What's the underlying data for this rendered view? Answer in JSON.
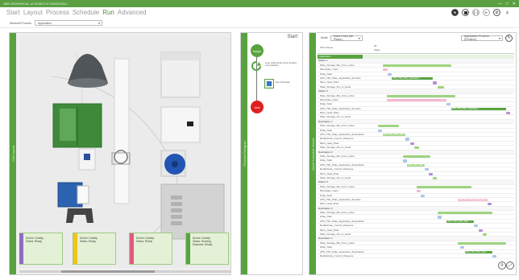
{
  "window": {
    "title": "ABB   GRAPHICAL-UI   ROBOTIC WORKCELL",
    "controls": [
      "—",
      "□",
      "✕"
    ]
  },
  "menu": {
    "items": [
      {
        "label": "Start",
        "active": false
      },
      {
        "label": "Layout",
        "active": false
      },
      {
        "label": "Process",
        "active": false
      },
      {
        "label": "Schedule",
        "active": false
      },
      {
        "label": "Run",
        "active": true
      },
      {
        "label": "Advanced",
        "active": false
      }
    ]
  },
  "toolbar": {
    "icons": [
      "record-icon",
      "stop-icon",
      "pause-icon",
      "play-icon",
      "settings-icon",
      "user-icon"
    ]
  },
  "workspace": {
    "label": "Workcell Process",
    "selected": "Application"
  },
  "layout_panel": {
    "strip_label": "Cell Layout",
    "devices": [
      {
        "name": "Device: Dosibly",
        "status": "Status: Ready",
        "stripe": "#8e6cc2"
      },
      {
        "name": "Device: Dosibly",
        "status": "Status: Ready",
        "stripe": "#f0c419"
      },
      {
        "name": "Device: Dosibly",
        "status": "Status: Ready",
        "stripe": "#e05a7c"
      },
      {
        "name": "Device: Dosibly",
        "status": "Status: Running",
        "extra": "Dispense: Ready",
        "stripe": "#58a33f"
      }
    ]
  },
  "flow_panel": {
    "strip_label": "Process Designer",
    "title": "Start",
    "begin": "begin",
    "end": "end",
    "loop_note": "Loop while all the work remains uncompleted",
    "task_note": "Run Schedule",
    "colors": {
      "begin": "#58a33f",
      "end": "#e02020"
    }
  },
  "gantt_panel": {
    "strip_label": "Gantt Schedule Viewer",
    "mode_label": "Mode",
    "mode_value": "Gantt Chart (All Plates)",
    "filter_value": "Application Process (Runtime)",
    "header_left": "Show Steps",
    "header_mid": "00",
    "header_sub": "Steps",
    "highlight_label": "Application",
    "rows": [
      {
        "label": "Station 1",
        "group": true
      },
      {
        "label": "Plate_Storage_Bot_From_Hotel",
        "bars": [
          [
            0.05,
            0.55,
            "#9ed480"
          ]
        ]
      },
      {
        "label": "Microplate_Open",
        "bars": [
          [
            0.05,
            0.09,
            "#f5b8cf"
          ]
        ]
      },
      {
        "label": "Wrap_Start",
        "bars": [
          [
            0.09,
            0.12,
            "#a6c7e8"
          ]
        ]
      },
      {
        "label": "APS_TSK_Plate_Application_Domain",
        "bars": [
          [
            0.12,
            0.42,
            "#58a33f"
          ]
        ],
        "inline": "APS_TSK_Plate_Application"
      },
      {
        "label": "Micro_Seal_Plate",
        "bars": [
          [
            0.42,
            0.45,
            "#b48fd6"
          ]
        ]
      },
      {
        "label": "Plate_Storage_Put_In_Hotel",
        "bars": [
          [
            0.45,
            0.5,
            "#9ed480"
          ]
        ]
      },
      {
        "label": "Station 2",
        "group": true
      },
      {
        "label": "Plate_Storage_Bot_From_Hotel",
        "bars": [
          [
            0.08,
            0.58,
            "#9ed480"
          ]
        ]
      },
      {
        "label": "Microplate_Open",
        "bars": [
          [
            0.08,
            0.52,
            "#f5b8cf"
          ]
        ]
      },
      {
        "label": "Wrap_Start",
        "bars": [
          [
            0.52,
            0.55,
            "#a6c7e8"
          ]
        ]
      },
      {
        "label": "APS_TSK_Plate_Application_Domain",
        "bars": [
          [
            0.55,
            0.95,
            "#58a33f"
          ]
        ],
        "inline": "APS_TSK_Plate_Application"
      },
      {
        "label": "Micro_Seal_Plate",
        "bars": [
          [
            0.95,
            0.98,
            "#b48fd6"
          ]
        ]
      },
      {
        "label": "Plate_Storage_Put_In_Hotel",
        "bars": []
      },
      {
        "label": "Destination 1",
        "group": true
      },
      {
        "label": "Plate_Storage_Bot_From_Hotel",
        "bars": [
          [
            0.02,
            0.17,
            "#9ed480"
          ]
        ]
      },
      {
        "label": "Wrap_Start",
        "bars": [
          [
            0.02,
            0.05,
            "#a6c7e8"
          ]
        ]
      },
      {
        "label": "APS_TSK_Plate_Application_Destination",
        "bars": [
          [
            0.05,
            0.22,
            "#9ed480"
          ]
        ],
        "inline": "APS_TSK_Plate_Dest"
      },
      {
        "label": "Redistribute_Control_Dispense",
        "bars": [
          [
            0.22,
            0.25,
            "#a6c7e8"
          ]
        ]
      },
      {
        "label": "Micro_Seal_Plate",
        "bars": [
          [
            0.25,
            0.28,
            "#b48fd6"
          ]
        ]
      },
      {
        "label": "Plate_Storage_Put_In_Hotel",
        "bars": [
          [
            0.28,
            0.32,
            "#9ed480"
          ]
        ]
      },
      {
        "label": "Destination 2",
        "group": true
      },
      {
        "label": "Plate_Storage_Bot_From_Hotel",
        "bars": [
          [
            0.2,
            0.4,
            "#9ed480"
          ]
        ]
      },
      {
        "label": "Wrap_Start",
        "bars": [
          [
            0.2,
            0.23,
            "#a6c7e8"
          ]
        ]
      },
      {
        "label": "APS_TSK_Plate_Application_Destination",
        "bars": [
          [
            0.23,
            0.36,
            "#9ed480"
          ]
        ],
        "inline": "APS_TSK_Plate_Dest"
      },
      {
        "label": "Redistribute_Control_Dispense",
        "bars": [
          [
            0.36,
            0.39,
            "#a6c7e8"
          ]
        ]
      },
      {
        "label": "Micro_Seal_Plate",
        "bars": [
          [
            0.39,
            0.42,
            "#b48fd6"
          ]
        ]
      },
      {
        "label": "Plate_Storage_Put_In_Hotel",
        "bars": [
          [
            0.42,
            0.45,
            "#9ed480"
          ]
        ]
      },
      {
        "label": "Station 3",
        "group": true
      },
      {
        "label": "Plate_Storage_Bot_From_Hotel",
        "bars": [
          [
            0.3,
            0.7,
            "#9ed480"
          ]
        ]
      },
      {
        "label": "Microplate_Open",
        "bars": [
          [
            0.3,
            0.33,
            "#f5b8cf"
          ]
        ]
      },
      {
        "label": "Wrap_Start",
        "bars": [
          [
            0.33,
            0.36,
            "#a6c7e8"
          ]
        ]
      },
      {
        "label": "APS_TSK_Plate_Application_Domain",
        "bars": [
          [
            0.6,
            0.82,
            "#f5b8cf"
          ]
        ],
        "inline": "APS_TSK_Plate_Application"
      },
      {
        "label": "Micro_Seal_Plate",
        "bars": [
          [
            0.82,
            0.85,
            "#b48fd6"
          ]
        ]
      },
      {
        "label": "Destination 3",
        "group": true
      },
      {
        "label": "Plate_Storage_Bot_From_Hotel",
        "bars": [
          [
            0.45,
            0.85,
            "#9ed480"
          ]
        ]
      },
      {
        "label": "Wrap_Start",
        "bars": [
          [
            0.45,
            0.48,
            "#a6c7e8"
          ]
        ]
      },
      {
        "label": "APS_TSK_Plate_Application_Destination",
        "bars": [
          [
            0.52,
            0.72,
            "#58a33f"
          ]
        ],
        "inline": "APS_TSK_Plate_Dest"
      },
      {
        "label": "Redistribute_Control_Dispense",
        "bars": [
          [
            0.72,
            0.75,
            "#a6c7e8"
          ]
        ]
      },
      {
        "label": "Micro_Seal_Plate",
        "bars": [
          [
            0.75,
            0.78,
            "#b48fd6"
          ]
        ]
      },
      {
        "label": "Plate_Storage_Put_In_Hotel",
        "bars": [
          [
            0.78,
            0.81,
            "#9ed480"
          ]
        ]
      },
      {
        "label": "Destination 4",
        "group": true
      },
      {
        "label": "Plate_Storage_Bot_From_Hotel",
        "bars": [
          [
            0.6,
            0.95,
            "#9ed480"
          ]
        ]
      },
      {
        "label": "Wrap_Start",
        "bars": [
          [
            0.62,
            0.65,
            "#a6c7e8"
          ]
        ]
      },
      {
        "label": "APS_TSK_Plate_Application_Destination",
        "bars": [
          [
            0.65,
            0.85,
            "#58a33f"
          ]
        ],
        "inline": "APS_TSK_Plate_Dest"
      },
      {
        "label": "Redistribute_Control_Dispense",
        "bars": [
          [
            0.85,
            0.88,
            "#a6c7e8"
          ]
        ]
      }
    ]
  }
}
